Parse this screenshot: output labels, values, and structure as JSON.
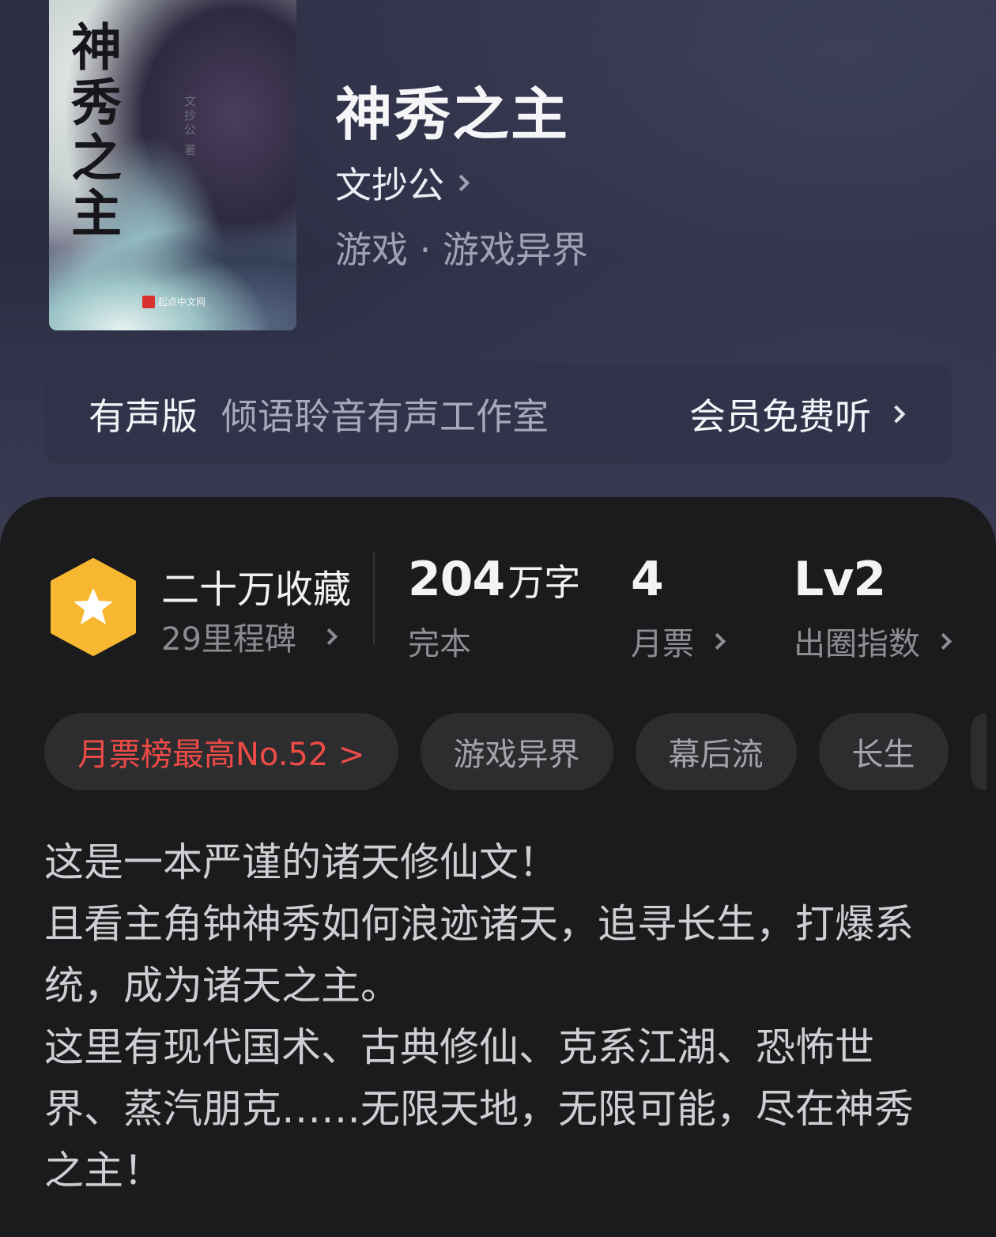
{
  "cover": {
    "title_text": "神秀之主",
    "author_text": "文抄公 著",
    "publisher_text": "起点中文网"
  },
  "book": {
    "title": "神秀之主",
    "author": "文抄公",
    "genre": "游戏 · 游戏异界"
  },
  "audio": {
    "tag": "有声版",
    "studio": "倾语聆音有声工作室",
    "action": "会员免费听"
  },
  "stats": {
    "favorites": "二十万收藏",
    "milestones": "29里程碑",
    "word_count": "204",
    "word_unit": "万字",
    "status": "完本",
    "monthly_votes": "4",
    "monthly_votes_label": "月票",
    "level": "Lv2",
    "level_label": "出圈指数"
  },
  "tags": [
    "月票榜最高No.52 >",
    "游戏异界",
    "幕后流",
    "长生"
  ],
  "intro": [
    "这是一本严谨的诸天修仙文！",
    "且看主角钟神秀如何浪迹诸天，追寻长生，打爆系统，成为诸天之主。",
    "这里有现代国术、古典修仙、克系江湖、恐怖世界、蒸汽朋克……无限天地，无限可能，尽在神秀之主！"
  ],
  "colors": {
    "hero_bg": "#2c2f44",
    "sheet_bg": "#1b1b1d",
    "badge": "#f7b731",
    "rank_text": "#ee4b47"
  }
}
